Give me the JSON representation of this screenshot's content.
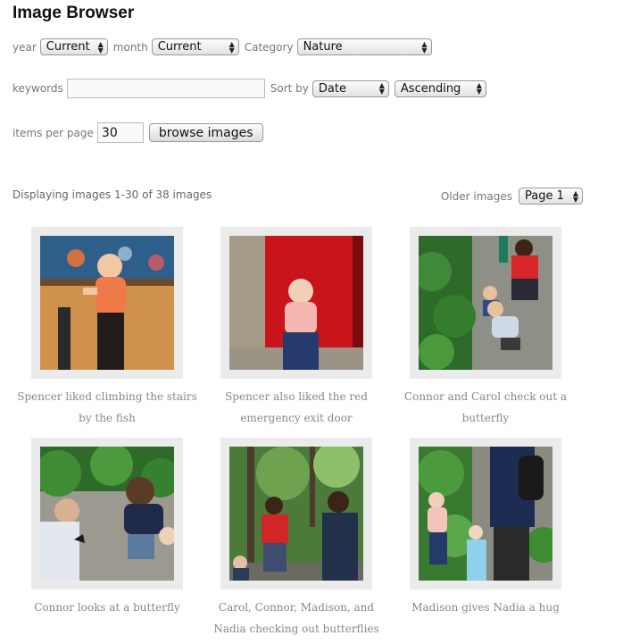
{
  "page": {
    "title": "Image Browser"
  },
  "filters": {
    "year_label": "year",
    "year_value": "Current",
    "month_label": "month",
    "month_value": "Current",
    "category_label": "Category",
    "category_value": "Nature",
    "keywords_label": "keywords",
    "keywords_value": "",
    "sortby_label": "Sort by",
    "sort_field": "Date",
    "sort_order": "Ascending",
    "items_label": "items per page",
    "items_value": "30",
    "browse_label": "browse images"
  },
  "status": {
    "text": "Displaying images 1-30 of 38 images"
  },
  "pager": {
    "label": "Older images",
    "value": "Page 1"
  },
  "images": [
    {
      "caption": "Spencer liked climbing the stairs by the fish"
    },
    {
      "caption": "Spencer also liked the red emergency exit door"
    },
    {
      "caption": "Connor and Carol check out a butterfly"
    },
    {
      "caption": "Connor looks at a butterfly"
    },
    {
      "caption": "Carol, Connor, Madison, and Nadia checking out butterflies"
    },
    {
      "caption": "Madison gives Nadia a hug"
    }
  ]
}
